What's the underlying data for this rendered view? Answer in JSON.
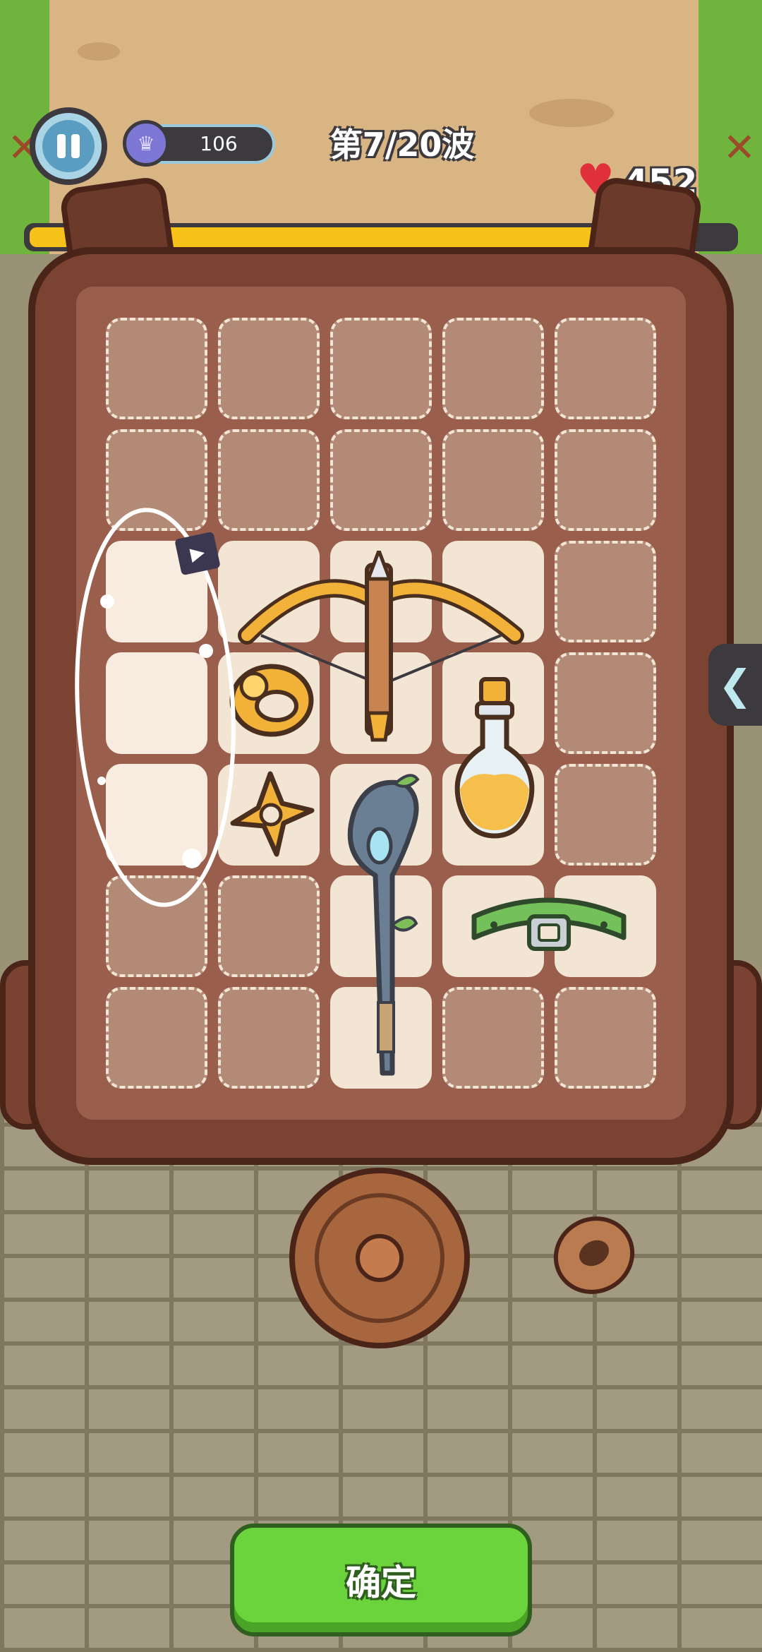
{
  "hud": {
    "crown_value": "106",
    "wave_label": "第7/20波",
    "hp_value": "452",
    "wave_progress": 0.94
  },
  "icons": {
    "pause": "pause-icon",
    "crown": "crown-icon",
    "heart": "heart-icon",
    "ad": "video-ad-icon",
    "expand": "chevron-left-icon"
  },
  "backpack": {
    "rows": 7,
    "cols": 5,
    "items": [
      "golden-crossbow",
      "golden-ring",
      "golden-shuriken",
      "potion-bottle",
      "magic-staff",
      "green-belt"
    ]
  },
  "floor_items": [
    "wooden-shield",
    "wooden-ring"
  ],
  "actions": {
    "confirm_label": "确定"
  },
  "colors": {
    "confirm_green": "#6bd33c",
    "wave_bar_yellow": "#f6c21a",
    "bag_brown": "#7b4331"
  }
}
